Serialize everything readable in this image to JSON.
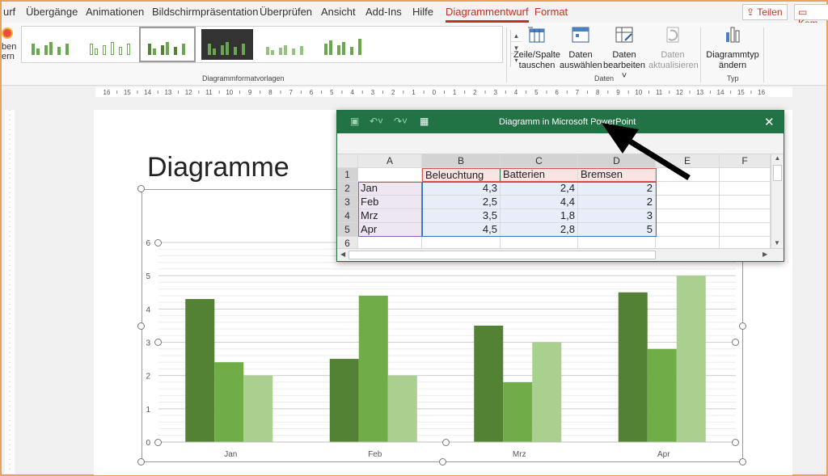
{
  "menu": {
    "tabs": [
      "urf",
      "Übergänge",
      "Animationen",
      "Bildschirmpräsentation",
      "Überprüfen",
      "Ansicht",
      "Add-Ins",
      "Hilfe",
      "Diagrammentwurf",
      "Format"
    ],
    "share_label": "Teilen",
    "comment_label": "Kom"
  },
  "ribbon": {
    "left_partial_1": "ben",
    "left_partial_2": "ern",
    "styles_group_label": "Diagrammformatvorlagen",
    "data_group_label": "Daten",
    "type_group_label": "Typ",
    "buttons": {
      "switch_row_col_1": "Zeile/Spalte",
      "switch_row_col_2": "tauschen",
      "select_data_1": "Daten",
      "select_data_2": "auswählen",
      "edit_data_1": "Daten",
      "edit_data_2": "bearbeiten",
      "refresh_data_1": "Daten",
      "refresh_data_2": "aktualisieren",
      "change_type_1": "Diagrammtyp",
      "change_type_2": "ändern"
    }
  },
  "ruler": {
    "h_labels": [
      "16",
      "15",
      "14",
      "13",
      "12",
      "11",
      "10",
      "9",
      "8",
      "7",
      "6",
      "5",
      "4",
      "3",
      "2",
      "1",
      "0",
      "1",
      "2",
      "3",
      "4",
      "5",
      "6",
      "7",
      "8",
      "9",
      "10",
      "11",
      "12",
      "13",
      "14",
      "15",
      "16"
    ]
  },
  "slide": {
    "title": "Diagramme"
  },
  "excel": {
    "title": "Diagramm in Microsoft PowerPoint",
    "columns": [
      "A",
      "B",
      "C",
      "D",
      "E",
      "F"
    ],
    "rows": [
      [
        "",
        "Beleuchtung",
        "Batterien",
        "Bremsen",
        "",
        ""
      ],
      [
        "Jan",
        "4,3",
        "2,4",
        "2",
        "",
        ""
      ],
      [
        "Feb",
        "2,5",
        "4,4",
        "2",
        "",
        ""
      ],
      [
        "Mrz",
        "3,5",
        "1,8",
        "3",
        "",
        ""
      ],
      [
        "Apr",
        "4,5",
        "2,8",
        "5",
        "",
        ""
      ],
      [
        "",
        "",
        "",
        "",
        "",
        ""
      ]
    ],
    "row_numbers": [
      "1",
      "2",
      "3",
      "4",
      "5",
      "6"
    ]
  },
  "chart_data": {
    "type": "bar",
    "categories": [
      "Jan",
      "Feb",
      "Mrz",
      "Apr"
    ],
    "series": [
      {
        "values": [
          4.3,
          2.5,
          3.5,
          4.5
        ],
        "color": "#548235"
      },
      {
        "values": [
          2.4,
          4.4,
          1.8,
          2.8
        ],
        "color": "#70ad47"
      },
      {
        "values": [
          2,
          2,
          3,
          5
        ],
        "color": "#a9d08e"
      }
    ],
    "title": "",
    "ylim": [
      0,
      6
    ],
    "yticks": [
      "0",
      "1",
      "2",
      "3",
      "4",
      "5",
      "6"
    ],
    "grid": true,
    "legend": "none"
  }
}
